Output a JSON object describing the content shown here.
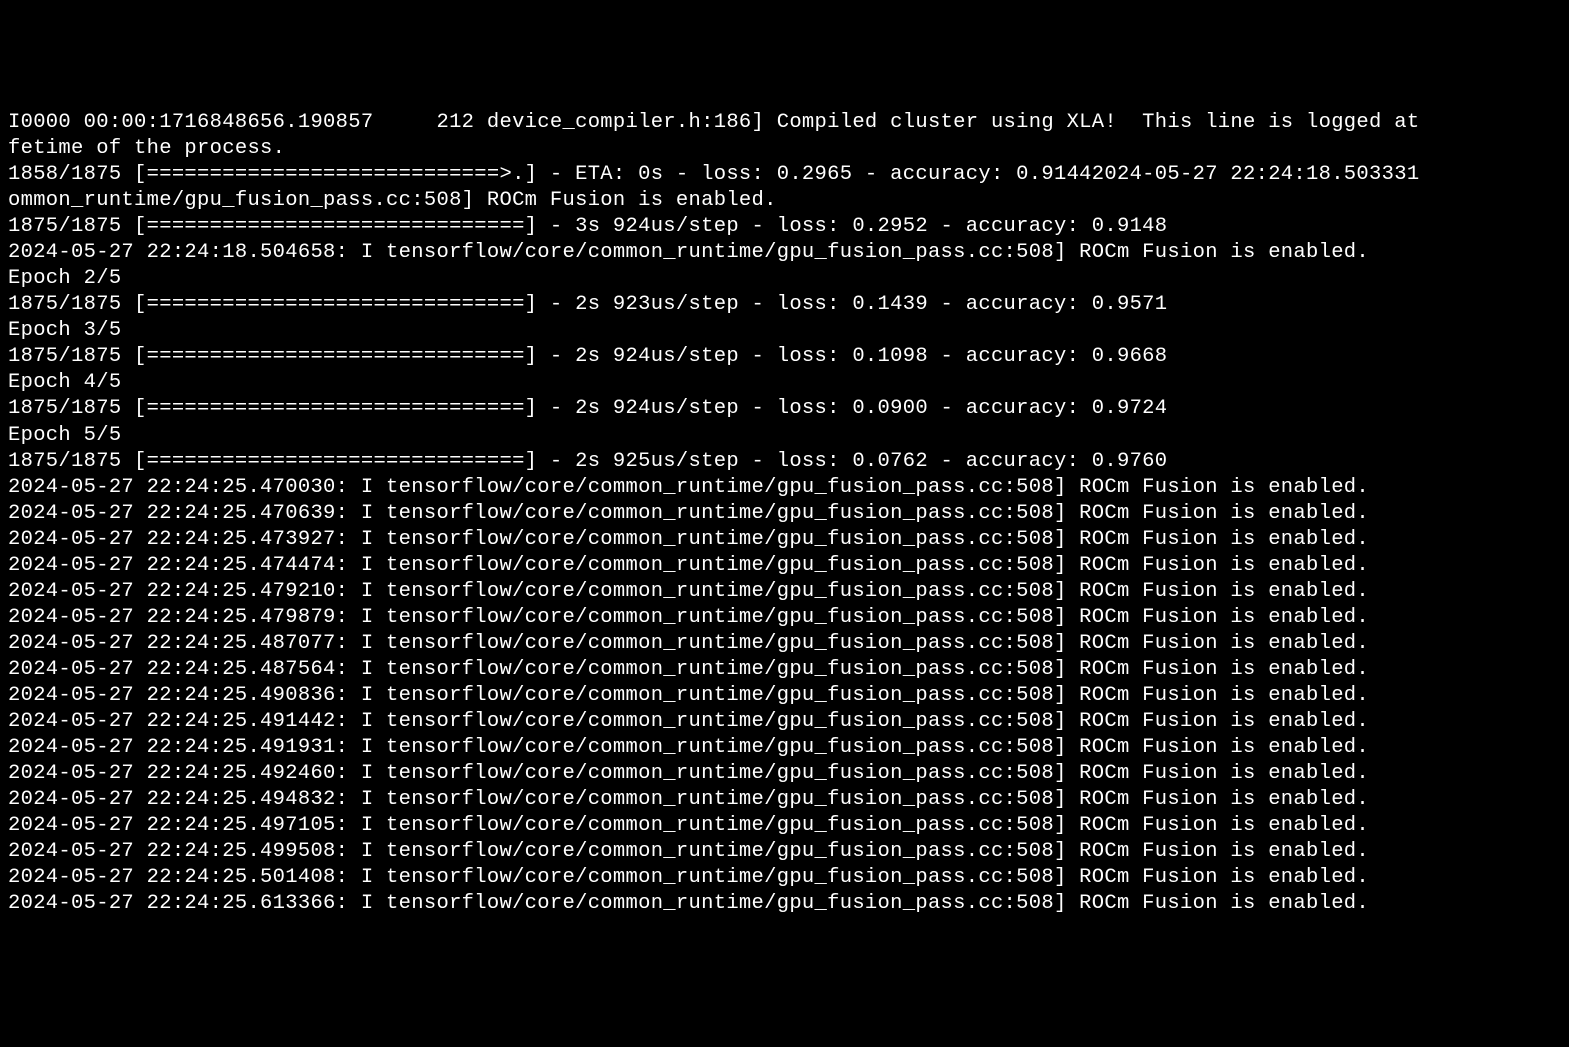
{
  "terminal": {
    "lines": [
      "I0000 00:00:1716848656.190857     212 device_compiler.h:186] Compiled cluster using XLA!  This line is logged at",
      "fetime of the process.",
      "1858/1875 [============================>.] - ETA: 0s - loss: 0.2965 - accuracy: 0.91442024-05-27 22:24:18.503331",
      "ommon_runtime/gpu_fusion_pass.cc:508] ROCm Fusion is enabled.",
      "1875/1875 [==============================] - 3s 924us/step - loss: 0.2952 - accuracy: 0.9148",
      "2024-05-27 22:24:18.504658: I tensorflow/core/common_runtime/gpu_fusion_pass.cc:508] ROCm Fusion is enabled.",
      "Epoch 2/5",
      "1875/1875 [==============================] - 2s 923us/step - loss: 0.1439 - accuracy: 0.9571",
      "Epoch 3/5",
      "1875/1875 [==============================] - 2s 924us/step - loss: 0.1098 - accuracy: 0.9668",
      "Epoch 4/5",
      "1875/1875 [==============================] - 2s 924us/step - loss: 0.0900 - accuracy: 0.9724",
      "Epoch 5/5",
      "1875/1875 [==============================] - 2s 925us/step - loss: 0.0762 - accuracy: 0.9760",
      "2024-05-27 22:24:25.470030: I tensorflow/core/common_runtime/gpu_fusion_pass.cc:508] ROCm Fusion is enabled.",
      "2024-05-27 22:24:25.470639: I tensorflow/core/common_runtime/gpu_fusion_pass.cc:508] ROCm Fusion is enabled.",
      "2024-05-27 22:24:25.473927: I tensorflow/core/common_runtime/gpu_fusion_pass.cc:508] ROCm Fusion is enabled.",
      "2024-05-27 22:24:25.474474: I tensorflow/core/common_runtime/gpu_fusion_pass.cc:508] ROCm Fusion is enabled.",
      "2024-05-27 22:24:25.479210: I tensorflow/core/common_runtime/gpu_fusion_pass.cc:508] ROCm Fusion is enabled.",
      "2024-05-27 22:24:25.479879: I tensorflow/core/common_runtime/gpu_fusion_pass.cc:508] ROCm Fusion is enabled.",
      "2024-05-27 22:24:25.487077: I tensorflow/core/common_runtime/gpu_fusion_pass.cc:508] ROCm Fusion is enabled.",
      "2024-05-27 22:24:25.487564: I tensorflow/core/common_runtime/gpu_fusion_pass.cc:508] ROCm Fusion is enabled.",
      "2024-05-27 22:24:25.490836: I tensorflow/core/common_runtime/gpu_fusion_pass.cc:508] ROCm Fusion is enabled.",
      "2024-05-27 22:24:25.491442: I tensorflow/core/common_runtime/gpu_fusion_pass.cc:508] ROCm Fusion is enabled.",
      "2024-05-27 22:24:25.491931: I tensorflow/core/common_runtime/gpu_fusion_pass.cc:508] ROCm Fusion is enabled.",
      "2024-05-27 22:24:25.492460: I tensorflow/core/common_runtime/gpu_fusion_pass.cc:508] ROCm Fusion is enabled.",
      "2024-05-27 22:24:25.494832: I tensorflow/core/common_runtime/gpu_fusion_pass.cc:508] ROCm Fusion is enabled.",
      "2024-05-27 22:24:25.497105: I tensorflow/core/common_runtime/gpu_fusion_pass.cc:508] ROCm Fusion is enabled.",
      "2024-05-27 22:24:25.499508: I tensorflow/core/common_runtime/gpu_fusion_pass.cc:508] ROCm Fusion is enabled.",
      "2024-05-27 22:24:25.501408: I tensorflow/core/common_runtime/gpu_fusion_pass.cc:508] ROCm Fusion is enabled.",
      "2024-05-27 22:24:25.613366: I tensorflow/core/common_runtime/gpu_fusion_pass.cc:508] ROCm Fusion is enabled."
    ]
  }
}
